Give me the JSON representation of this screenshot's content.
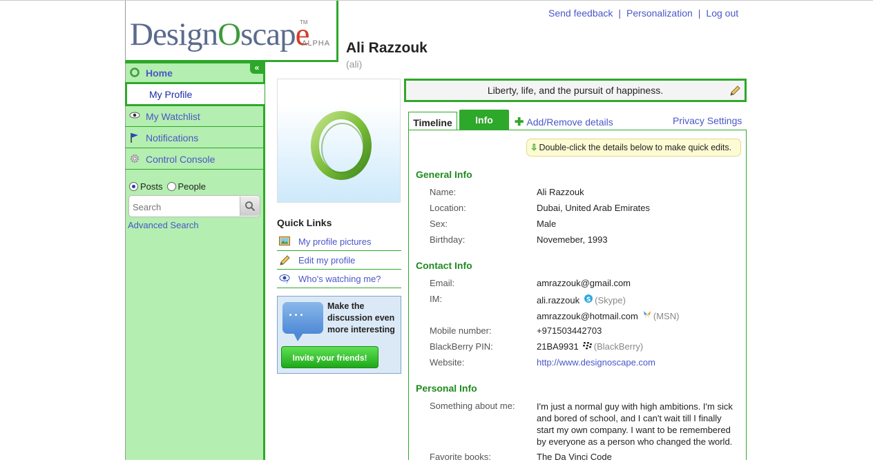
{
  "logo": {
    "text_main": "DesignOscape",
    "part1": "Design",
    "part_o": "O",
    "part2": "scap",
    "part_e": "e",
    "tm": "TM",
    "badge": "ALPHA"
  },
  "header_links": {
    "feedback": "Send feedback",
    "personalization": "Personalization",
    "logout": "Log out",
    "separator": "|"
  },
  "sidebar": {
    "collapse": "«",
    "home": "Home",
    "my_profile": "My Profile",
    "watchlist": "My Watchlist",
    "notifications": "Notifications",
    "control_console": "Control Console",
    "search": {
      "option_posts": "Posts",
      "option_people": "People",
      "selected": "Posts",
      "placeholder": "Search",
      "advanced": "Advanced Search"
    }
  },
  "profile": {
    "name": "Ali Razzouk",
    "handle": "(ali)",
    "status": "Liberty, life, and the pursuit of happiness."
  },
  "quick_links": {
    "title": "Quick Links",
    "items": [
      "My profile pictures",
      "Edit my profile",
      "Who's watching me?"
    ]
  },
  "invite": {
    "text": "Make the discussion even more interesting",
    "button": "Invite your friends!"
  },
  "tabs": {
    "timeline": "Timeline",
    "info": "Info",
    "active": "Info",
    "add_remove": "Add/Remove details",
    "privacy": "Privacy Settings"
  },
  "hint": "Double-click the details below to make quick edits.",
  "general_info": {
    "title": "General Info",
    "name_label": "Name:",
    "name": "Ali Razzouk",
    "location_label": "Location:",
    "location": "Dubai, United Arab Emirates",
    "sex_label": "Sex:",
    "sex": "Male",
    "birthday_label": "Birthday:",
    "birthday": "Novemeber, 1993"
  },
  "contact_info": {
    "title": "Contact Info",
    "email_label": "Email:",
    "email": "amrazzouk@gmail.com",
    "im_label": "IM:",
    "im_skype": "ali.razzouk",
    "im_skype_service": "(Skype)",
    "im_msn": "amrazzouk@hotmail.com",
    "im_msn_service": "(MSN)",
    "mobile_label": "Mobile number:",
    "mobile": "+971503442703",
    "bb_label": "BlackBerry PIN:",
    "bb": "21BA9931",
    "bb_service": "(BlackBerry)",
    "website_label": "Website:",
    "website": "http://www.designoscape.com"
  },
  "personal_info": {
    "title": "Personal Info",
    "about_label": "Something about me:",
    "about": "I'm just a normal guy with high ambitions. I'm sick and bored of school, and I can't wait till I finally start my own company. I want to be remembered by everyone as a person who changed the world.",
    "books_label": "Favorite books:",
    "books": "The Da Vinci Code"
  },
  "colors": {
    "accent_green": "#2ea82a",
    "sidebar_bg": "#b4eeb0",
    "link": "#4a56c8"
  }
}
